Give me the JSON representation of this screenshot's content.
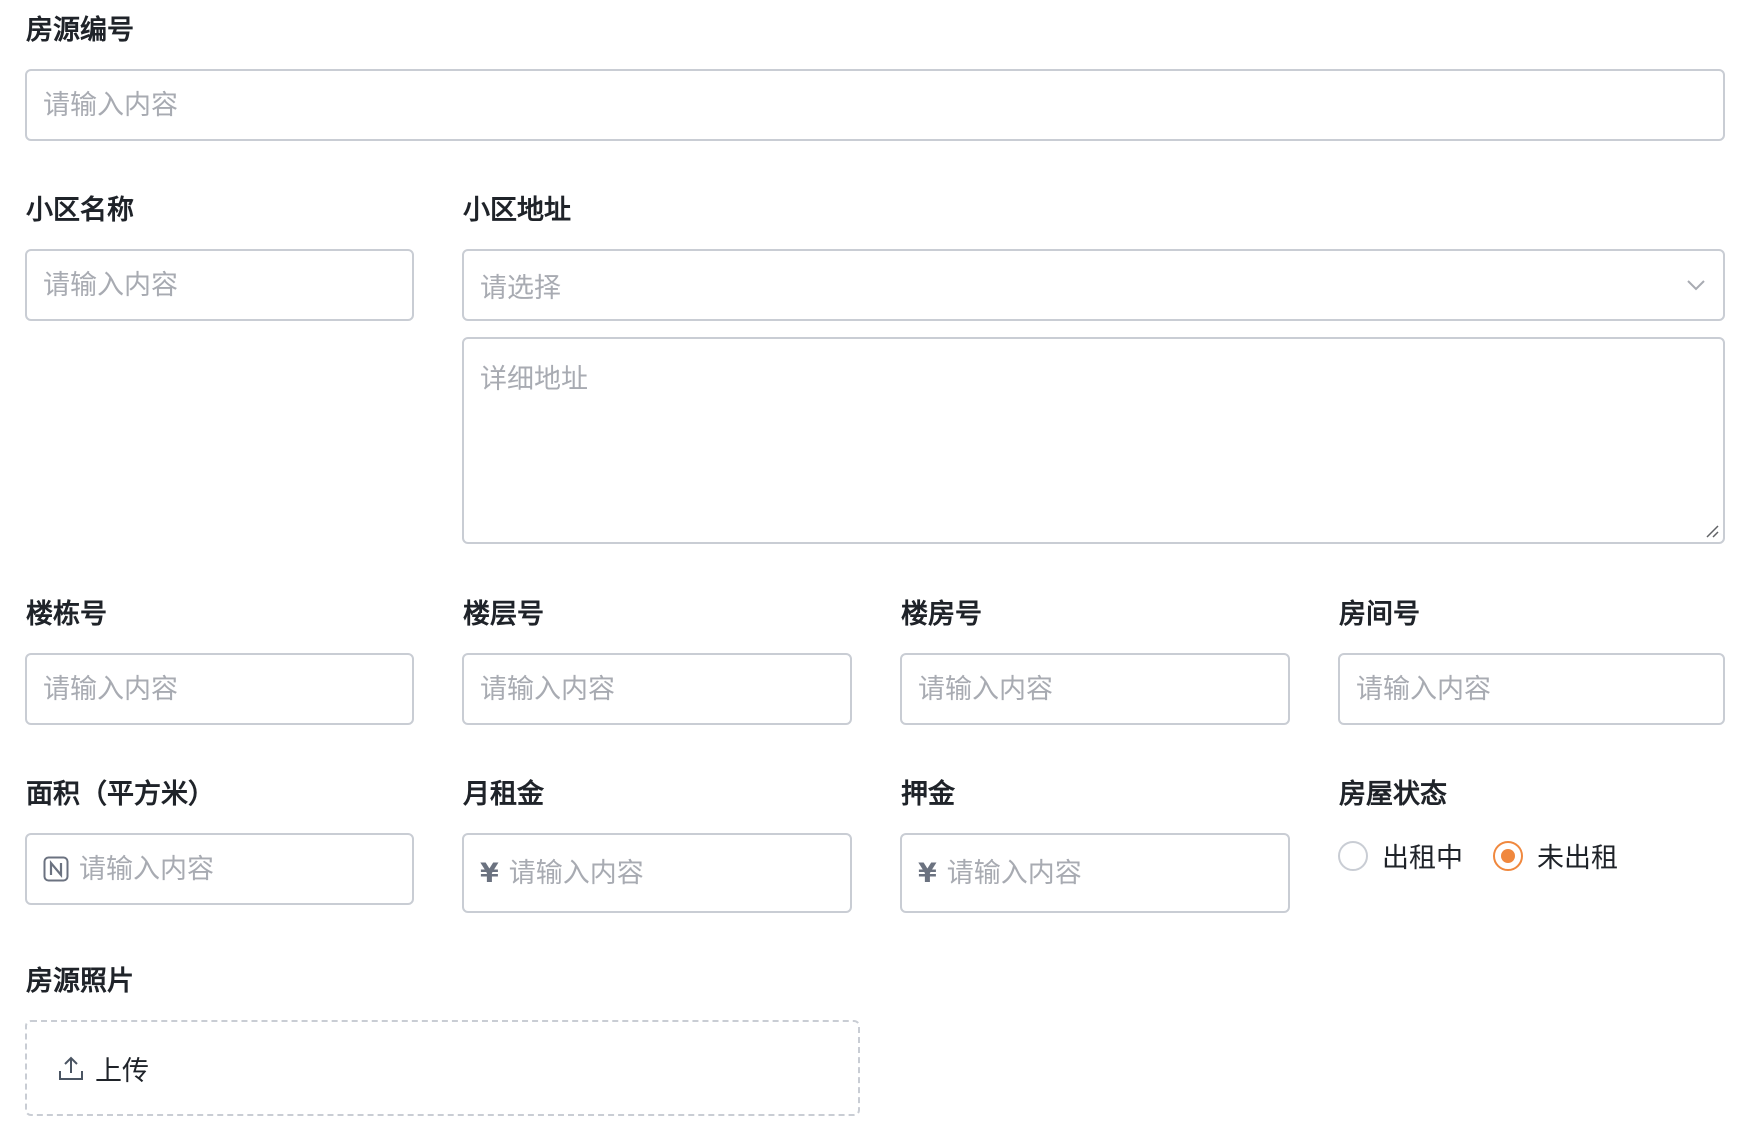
{
  "form": {
    "listing_id": {
      "label": "房源编号",
      "placeholder": "请输入内容"
    },
    "community_name": {
      "label": "小区名称",
      "placeholder": "请输入内容"
    },
    "community_address": {
      "label": "小区地址",
      "select_placeholder": "请选择",
      "detail_placeholder": "详细地址",
      "chevron_icon": "chevron-down-icon"
    },
    "building_no": {
      "label": "楼栋号",
      "placeholder": "请输入内容"
    },
    "floor_no": {
      "label": "楼层号",
      "placeholder": "请输入内容"
    },
    "unit_no": {
      "label": "楼房号",
      "placeholder": "请输入内容"
    },
    "room_no": {
      "label": "房间号",
      "placeholder": "请输入内容"
    },
    "area": {
      "label": "面积（平方米）",
      "placeholder": "请输入内容",
      "icon": "number-icon"
    },
    "monthly_rent": {
      "label": "月租金",
      "placeholder": "请输入内容",
      "prefix": "¥"
    },
    "deposit": {
      "label": "押金",
      "placeholder": "请输入内容",
      "prefix": "¥"
    },
    "status": {
      "label": "房屋状态",
      "options": [
        {
          "label": "出租中",
          "checked": false
        },
        {
          "label": "未出租",
          "checked": true
        }
      ],
      "accent_color": "#f0883e"
    },
    "photos": {
      "label": "房源照片",
      "upload_label": "上传",
      "icon": "upload-icon"
    }
  }
}
